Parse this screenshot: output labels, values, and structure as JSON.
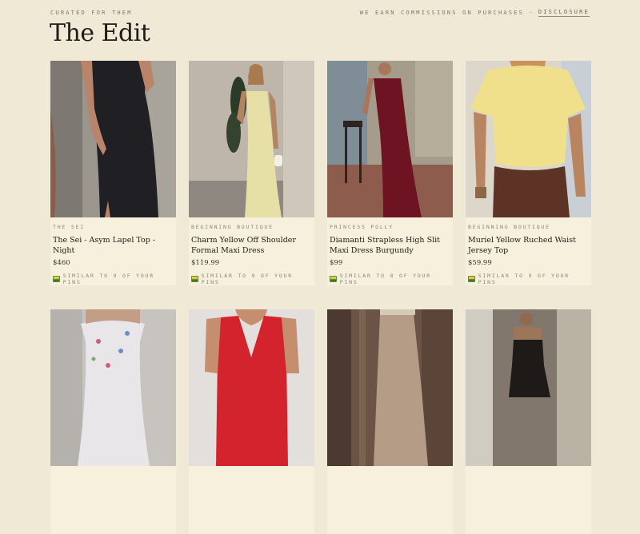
{
  "header": {
    "eyebrow": "CURATED FOR THEM",
    "commission_note": "WE EARN COMMISSIONS ON PURCHASES ·",
    "disclosure_link": "DISCLOSURE",
    "title": "The Edit"
  },
  "products": [
    {
      "brand": "THE SEI",
      "title": "The Sei - Asym Lapel Top - Night",
      "price": "$460",
      "similar": "SIMILAR TO 9 OF YOUR PINS",
      "image": "black-dress-photo"
    },
    {
      "brand": "BEGINNING BOUTIQUE",
      "title": "Charm Yellow Off Shoulder Formal Maxi Dress",
      "price": "$119.99",
      "similar": "SIMILAR TO 9 OF YOUR PINS",
      "image": "yellow-maxi-dress-photo"
    },
    {
      "brand": "PRINCESS POLLY",
      "title": "Diamanti Strapless High Slit Maxi Dress Burgundy",
      "price": "$99",
      "similar": "SIMILAR TO 8 OF YOUR PINS",
      "image": "burgundy-dress-photo"
    },
    {
      "brand": "BEGINNING BOUTIQUE",
      "title": "Muriel Yellow Ruched Waist Jersey Top",
      "price": "$59.99",
      "similar": "SIMILAR TO 9 OF YOUR PINS",
      "image": "yellow-top-photo"
    }
  ],
  "colors": {
    "background": "#efe9d6",
    "card": "#f6f0dd",
    "text": "#1e1b18",
    "muted": "#8a8478"
  }
}
